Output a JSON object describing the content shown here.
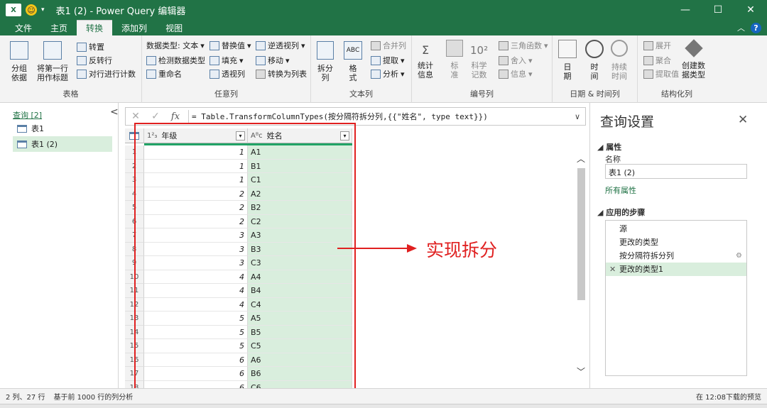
{
  "titlebar": {
    "app_icon": "X",
    "title": "表1 (2) - Power Query 编辑器",
    "controls": [
      "—",
      "☐",
      "✕"
    ]
  },
  "tabs": [
    "文件",
    "主页",
    "转换",
    "添加列",
    "视图"
  ],
  "active_tab": "转换",
  "ribbon": {
    "groups": {
      "table": {
        "label": "表格",
        "group_by": "分组\n依据",
        "use_first_row": "将第一行\n用作标题",
        "transpose": "转置",
        "reverse_rows": "反转行",
        "count_rows": "对行进行计数"
      },
      "any_column": {
        "label": "任意列",
        "data_type": "数据类型: 文本",
        "detect_type": "检测数据类型",
        "rename": "重命名",
        "replace_values": "替换值",
        "fill": "填充",
        "pivot_column": "透视列",
        "unpivot": "逆透视列",
        "move": "移动",
        "to_list": "转换为列表"
      },
      "text_column": {
        "label": "文本列",
        "split_column": "拆分\n列",
        "format": "格\n式",
        "merge_columns": "合并列",
        "extract": "提取",
        "parse": "分析"
      },
      "number_column": {
        "label": "编号列",
        "statistics": "统计\n信息",
        "standard": "标\n准",
        "scientific": "科学\n记数",
        "trig": "三角函数",
        "rounding": "舍入",
        "information": "信息"
      },
      "datetime_column": {
        "label": "日期 & 时间列",
        "date": "日\n期",
        "time": "时\n间",
        "duration": "持续\n时间"
      },
      "structured_column": {
        "label": "结构化列",
        "expand": "展开",
        "aggregate": "聚合",
        "extract_values": "提取值",
        "create_data_type": "创建数\n据类型"
      }
    }
  },
  "queries_pane": {
    "header": "查询 [2]",
    "collapse": "<",
    "items": [
      "表1",
      "表1 (2)"
    ]
  },
  "formula_bar": {
    "cancel": "✕",
    "confirm": "✓",
    "fx": "fx",
    "formula": "= Table.TransformColumnTypes(按分隔符拆分列,{{\"姓名\", type text}})"
  },
  "grid": {
    "columns": [
      {
        "type_icon": "1²₃",
        "name": "年级"
      },
      {
        "type_icon": "Aᴮc",
        "name": "姓名"
      }
    ],
    "rows": [
      [
        "1",
        "A1"
      ],
      [
        "1",
        "B1"
      ],
      [
        "1",
        "C1"
      ],
      [
        "2",
        "A2"
      ],
      [
        "2",
        "B2"
      ],
      [
        "2",
        "C2"
      ],
      [
        "3",
        "A3"
      ],
      [
        "3",
        "B3"
      ],
      [
        "3",
        "C3"
      ],
      [
        "4",
        "A4"
      ],
      [
        "4",
        "B4"
      ],
      [
        "4",
        "C4"
      ],
      [
        "5",
        "A5"
      ],
      [
        "5",
        "B5"
      ],
      [
        "5",
        "C5"
      ],
      [
        "6",
        "A6"
      ],
      [
        "6",
        "B6"
      ],
      [
        "6",
        "C6"
      ]
    ],
    "row_numbers": [
      "1",
      "2",
      "3",
      "4",
      "5",
      "6",
      "7",
      "8",
      "9",
      "10",
      "11",
      "12",
      "13",
      "14",
      "15",
      "16",
      "17",
      "18"
    ]
  },
  "annotation": "实现拆分",
  "query_settings": {
    "title": "查询设置",
    "close": "✕",
    "properties_header": "属性",
    "name_label": "名称",
    "name_value": "表1 (2)",
    "all_properties": "所有属性",
    "applied_steps_header": "应用的步骤",
    "steps": [
      "源",
      "更改的类型",
      "按分隔符拆分列",
      "更改的类型1"
    ]
  },
  "status": {
    "left1": "2 列、27 行",
    "left2": "基于前 1000 行的列分析",
    "right": "在 12:08下载的预览"
  }
}
